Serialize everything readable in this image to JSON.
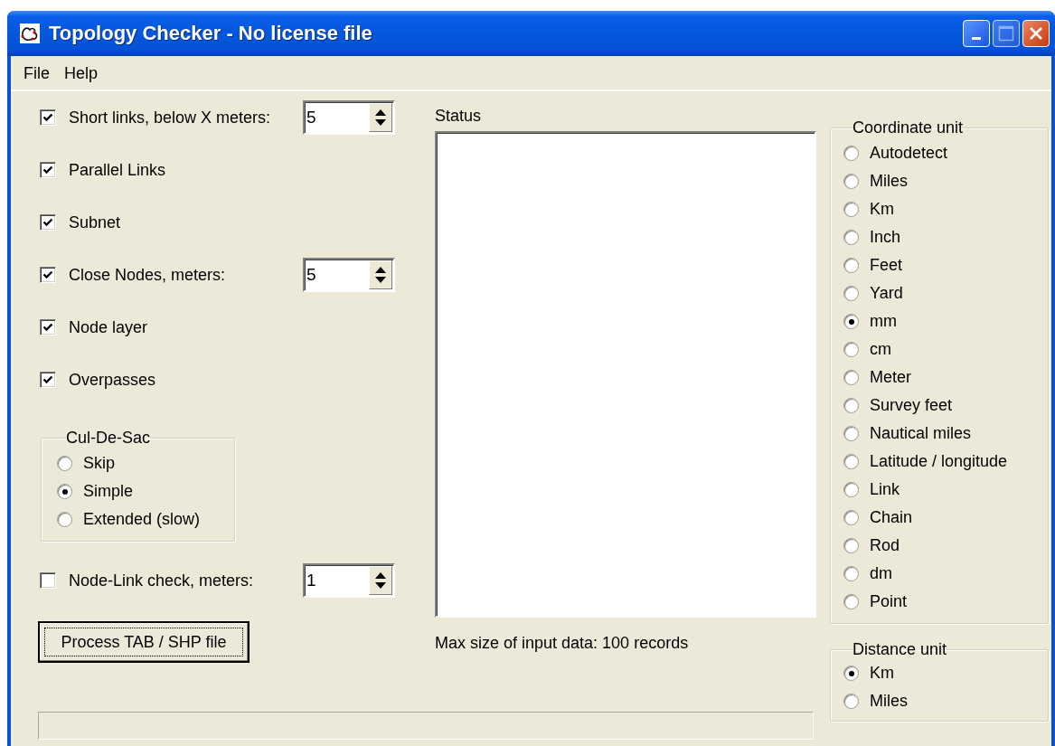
{
  "window": {
    "title": "Topology Checker - No license file"
  },
  "menu": [
    "File",
    "Help"
  ],
  "checks": [
    {
      "kind": "spin",
      "label": "Short links, below X meters:",
      "checked": true,
      "value": "5"
    },
    {
      "kind": "plain",
      "label": "Parallel Links",
      "checked": true
    },
    {
      "kind": "plain",
      "label": "Subnet",
      "checked": true
    },
    {
      "kind": "spin",
      "label": "Close Nodes, meters:",
      "checked": true,
      "value": "5"
    },
    {
      "kind": "plain",
      "label": "Node layer",
      "checked": true
    },
    {
      "kind": "plain",
      "label": "Overpasses",
      "checked": true
    }
  ],
  "cul_de_sac": {
    "title": "Cul-De-Sac",
    "options": [
      {
        "label": "Skip",
        "selected": false
      },
      {
        "label": "Simple",
        "selected": true
      },
      {
        "label": "Extended (slow)",
        "selected": false
      }
    ]
  },
  "node_link_check": {
    "kind": "spin",
    "label": "Node-Link check, meters:",
    "checked": false,
    "value": "1"
  },
  "process_button": "Process TAB / SHP file",
  "status": {
    "label": "Status",
    "note": "Max size of input data: 100 records"
  },
  "coordinate_unit": {
    "title": "Coordinate unit",
    "options": [
      {
        "label": "Autodetect",
        "selected": false
      },
      {
        "label": "Miles",
        "selected": false
      },
      {
        "label": "Km",
        "selected": false
      },
      {
        "label": "Inch",
        "selected": false
      },
      {
        "label": "Feet",
        "selected": false
      },
      {
        "label": "Yard",
        "selected": false
      },
      {
        "label": "mm",
        "selected": true
      },
      {
        "label": "cm",
        "selected": false
      },
      {
        "label": "Meter",
        "selected": false
      },
      {
        "label": "Survey feet",
        "selected": false
      },
      {
        "label": "Nautical miles",
        "selected": false
      },
      {
        "label": "Latitude / longitude",
        "selected": false
      },
      {
        "label": "Link",
        "selected": false
      },
      {
        "label": "Chain",
        "selected": false
      },
      {
        "label": "Rod",
        "selected": false
      },
      {
        "label": "dm",
        "selected": false
      },
      {
        "label": "Point",
        "selected": false
      }
    ]
  },
  "distance_unit": {
    "title": "Distance unit",
    "options": [
      {
        "label": "Km",
        "selected": true
      },
      {
        "label": "Miles",
        "selected": false
      }
    ]
  }
}
